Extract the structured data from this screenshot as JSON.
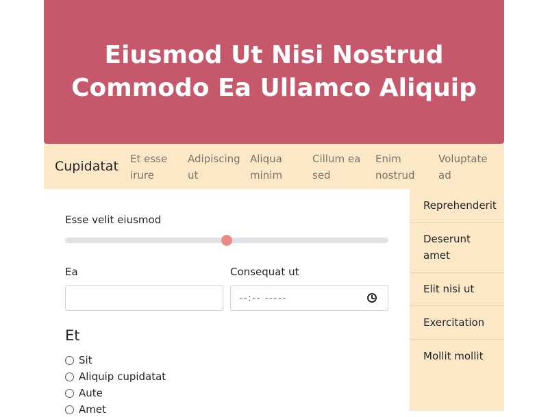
{
  "hero": {
    "title": "Eiusmod Ut Nisi Nostrud Commodo Ea Ullamco Aliquip"
  },
  "navbar": {
    "brand": "Cupidatat",
    "links": [
      {
        "line1": "Et esse",
        "line2": "irure"
      },
      {
        "line1": "Adipiscing",
        "line2": "ut"
      },
      {
        "line1": "Aliqua",
        "line2": "minim"
      },
      {
        "line1": "Cillum ea",
        "line2": "sed"
      },
      {
        "line1": "Enim",
        "line2": "nostrud"
      },
      {
        "line1": "Voluptate",
        "line2": "ad"
      }
    ]
  },
  "form": {
    "range_label": "Esse velit eiusmod",
    "range_value_percent": 50,
    "field1_label": "Ea",
    "field1_value": "",
    "field2_label": "Consequat ut",
    "field2_value": "--:-- -----",
    "radio_legend": "Et",
    "radio_options": [
      "Sit",
      "Aliquip cupidatat",
      "Aute",
      "Amet"
    ]
  },
  "sidebar": {
    "items": [
      {
        "line1": "Reprehenderit",
        "line2": ""
      },
      {
        "line1": "Deserunt",
        "line2": "amet"
      },
      {
        "line1": "Elit nisi ut",
        "line2": ""
      },
      {
        "line1": "Exercitation",
        "line2": ""
      },
      {
        "line1": "Mollit mollit",
        "line2": ""
      }
    ]
  },
  "colors": {
    "hero_bg": "#c5596b",
    "nav_bg": "#fce7c7",
    "slider_thumb": "#e98a88"
  },
  "icons": {
    "time_picker": "clock-icon"
  }
}
